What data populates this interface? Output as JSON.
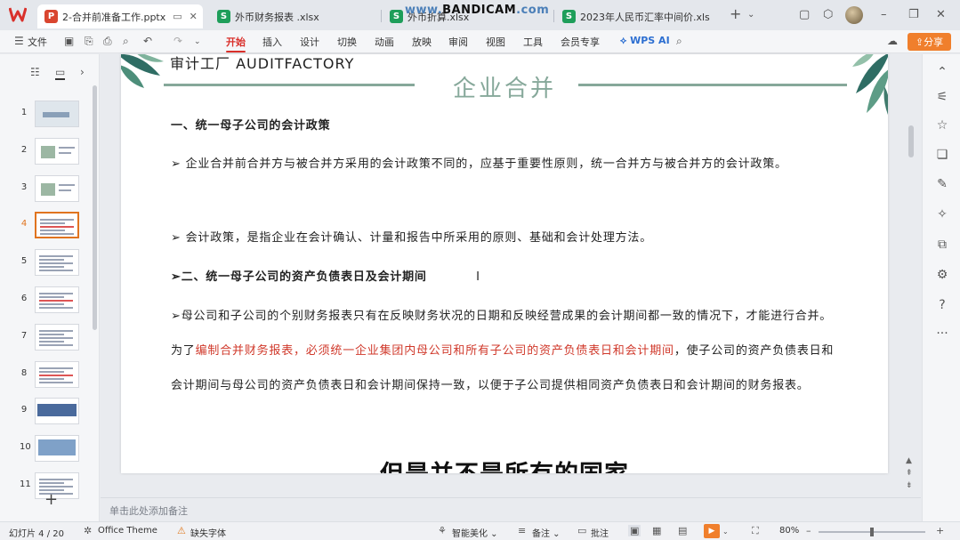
{
  "titlebar": {
    "tabs": [
      {
        "icon": "P",
        "label": "2-合并前准备工作.pptx"
      },
      {
        "icon": "S",
        "label": "外币财务报表 .xlsx"
      },
      {
        "icon": "S",
        "label": "外币折算.xlsx"
      },
      {
        "icon": "S",
        "label": "2023年人民币汇率中间价.xls"
      }
    ],
    "watermark_main": "www.",
    "watermark_brand": "BANDICAM",
    "watermark_end": ".com"
  },
  "ribbon": {
    "menu_file": "文件",
    "tabs": [
      "开始",
      "插入",
      "设计",
      "切换",
      "动画",
      "放映",
      "审阅",
      "视图",
      "工具",
      "会员专享"
    ],
    "wps_ai": "WPS AI",
    "share": "分享"
  },
  "thumbnails": {
    "numbers": [
      "1",
      "2",
      "3",
      "4",
      "5",
      "6",
      "7",
      "8",
      "9",
      "10",
      "11"
    ],
    "selected_index": 4
  },
  "slide": {
    "banner": "审计工厂 AUDITFACTORY",
    "title": "企业合并",
    "heading1": "一、统一母子公司的会计政策",
    "p1": "➢ 企业合并前合并方与被合并方采用的会计政策不同的，应基于重要性原则，统一合并方与被合并方的会计政策。",
    "p2": "➢ 会计政策，是指企业在会计确认、计量和报告中所采用的原则、基础和会计处理方法。",
    "heading2": "➢二、统一母子公司的资产负债表日及会计期间",
    "p3_a": "➢母公司和子公司的个别财务报表只有在反映财务状况的日期和反映经营成果的会计期间都一致的情况下，才能进行合并。为了",
    "p3_red": "编制合并财务报表，必须统一企业集团内母公司和所有子公司的资产负债表日和会计期间",
    "p3_b": "，使子公司的资产负债表日和会计期间与母公司的资产负债表日和会计期间保持一致，以便于子公司提供相同资产负债表日和会计期间的财务报表。",
    "caption": "但是并不是所有的国家"
  },
  "notes_placeholder": "单击此处添加备注",
  "statusbar": {
    "slide_counter": "幻灯片 4 / 20",
    "theme": "Office Theme",
    "missing_font": "缺失字体",
    "beautify": "智能美化",
    "notes": "备注",
    "comments": "批注",
    "zoom": "80%",
    "zoom_fraction": 0.5
  },
  "colors": {
    "accent_red": "#d9302b",
    "share_orange": "#f07f2c",
    "title_green": "#86a89a",
    "text_red": "#d0392b"
  }
}
